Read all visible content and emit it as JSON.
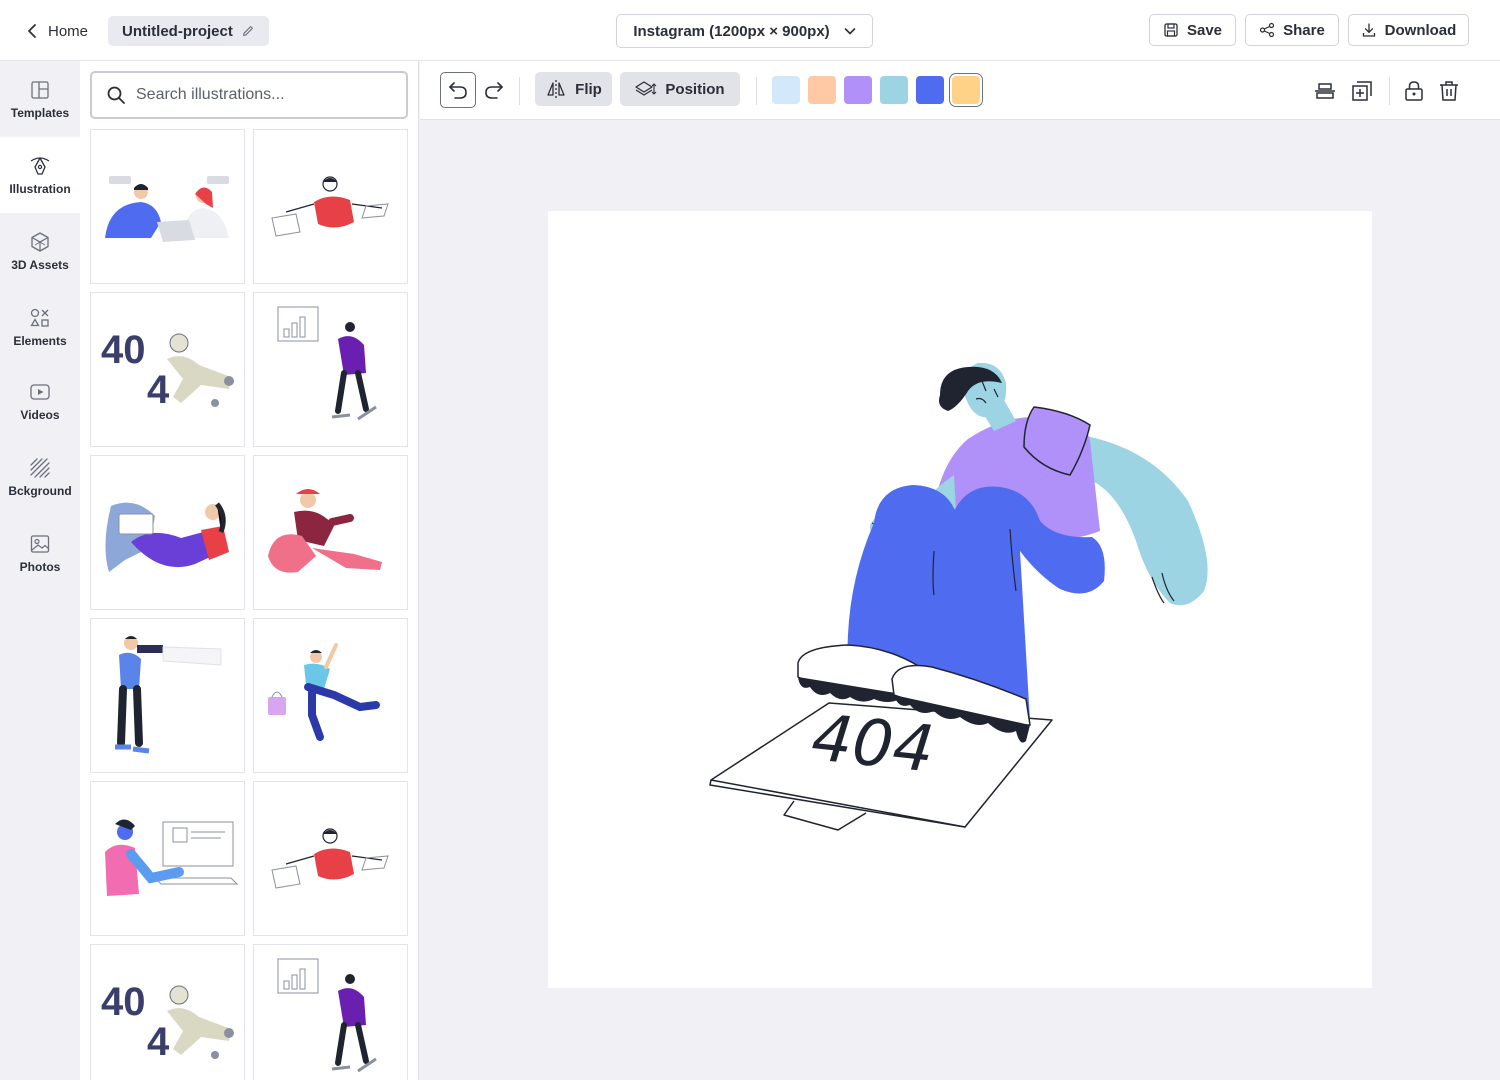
{
  "header": {
    "home_label": "Home",
    "project_name": "Untitled-project",
    "canvas_size": "Instagram (1200px × 900px)",
    "save_label": "Save",
    "share_label": "Share",
    "download_label": "Download"
  },
  "nav": {
    "items": [
      {
        "label": "Templates",
        "icon": "templates-icon"
      },
      {
        "label": "Illustration",
        "icon": "illustration-icon",
        "active": true
      },
      {
        "label": "3D Assets",
        "icon": "3d-assets-icon"
      },
      {
        "label": "Elements",
        "icon": "elements-icon"
      },
      {
        "label": "Videos",
        "icon": "videos-icon"
      },
      {
        "label": "Bckground",
        "icon": "background-icon"
      },
      {
        "label": "Photos",
        "icon": "photos-icon"
      }
    ]
  },
  "panel": {
    "search_placeholder": "Search illustrations..."
  },
  "toolbar": {
    "flip_label": "Flip",
    "position_label": "Position",
    "colors": [
      "#d3e8fb",
      "#fec9a4",
      "#b091f9",
      "#9cd4e3",
      "#4f6cf0",
      "#fed287"
    ],
    "selected_color": "#fed287"
  },
  "canvas": {
    "illustration_text": "404"
  },
  "colors": {
    "accent_blue": "#4f6cf0",
    "skin_cyan": "#9cd4e3",
    "shirt_purple": "#b091f9",
    "text_dark": "#2b2f3a"
  }
}
